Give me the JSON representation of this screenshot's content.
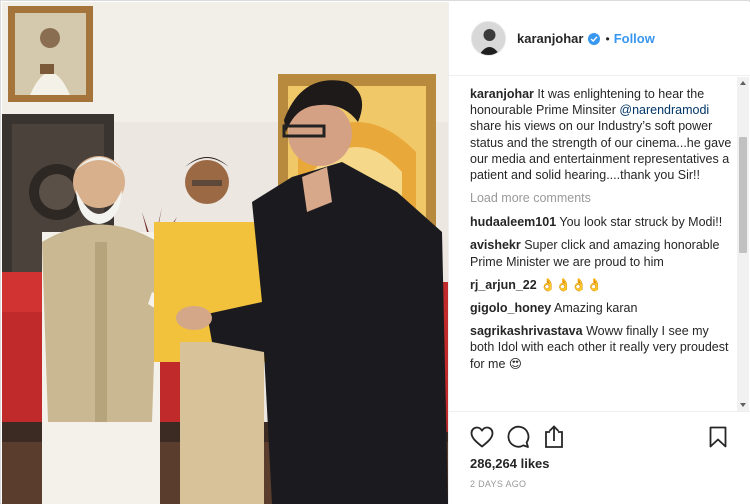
{
  "post": {
    "username": "karanjohar",
    "follow_label": "Follow",
    "separator": "•",
    "caption": {
      "username": "karanjohar",
      "text_before": " It was enlightening to hear the honourable Prime Minsiter ",
      "mention": "@narendramodi",
      "text_after": " share his views on our Industry’s soft power status and the strength of our cinema...he gave our media and entertainment representatives a patient and solid hearing....thank you Sir!!"
    },
    "load_more_label": "Load more comments",
    "comments": [
      {
        "username": "hudaaleem101",
        "text": " You look star struck by Modi!!"
      },
      {
        "username": "avishekr",
        "text": " Super click and amazing honorable Prime Minister we are proud to him"
      },
      {
        "username": "rj_arjun_22",
        "text": " 👌👌👌👌"
      },
      {
        "username": "gigolo_honey",
        "text": " Amazing karan"
      },
      {
        "username": "sagrikashrivastava",
        "text": " Woww finally I see my both Idol with each other it really very proudest for me 😍"
      }
    ],
    "likes": "286,264 likes",
    "timestamp": "2 DAYS AGO"
  },
  "icons": {
    "like": "heart-icon",
    "comment": "comment-bubble-icon",
    "share": "share-icon",
    "save": "bookmark-icon",
    "verified": "verified-badge-icon"
  },
  "colors": {
    "accent": "#3897f0",
    "mention": "#003569",
    "muted": "#999999",
    "text": "#262626"
  }
}
